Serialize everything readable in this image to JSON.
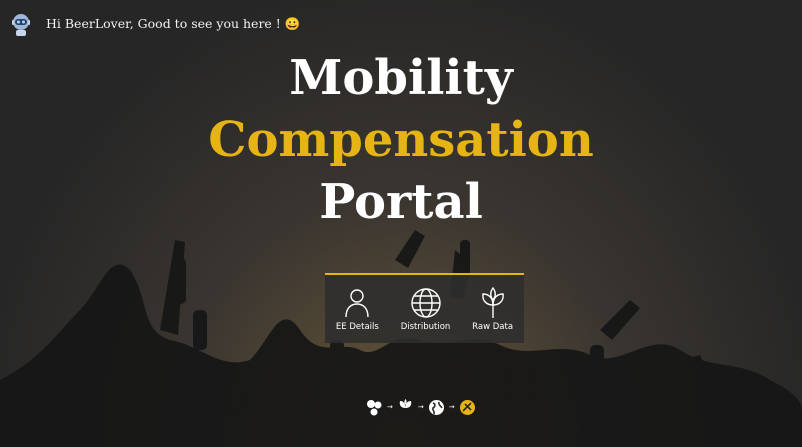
{
  "header": {
    "greeting": "Hi BeerLover, Good to see you here ! 😀"
  },
  "title": {
    "line1": "Mobility",
    "line2": "Compensation",
    "line3": "Portal"
  },
  "nav": {
    "items": [
      {
        "label": "EE Details",
        "icon": "person-icon"
      },
      {
        "label": "Distribution",
        "icon": "globe-icon"
      },
      {
        "label": "Raw Data",
        "icon": "leaf-icon"
      }
    ]
  },
  "flow": {
    "arrow": "→",
    "steps": [
      "clusters-icon",
      "leaf-icon",
      "globe-icon",
      "logo-icon"
    ]
  },
  "colors": {
    "accent": "#e7b416",
    "background": "#2b2b2b",
    "text": "#ffffff"
  }
}
